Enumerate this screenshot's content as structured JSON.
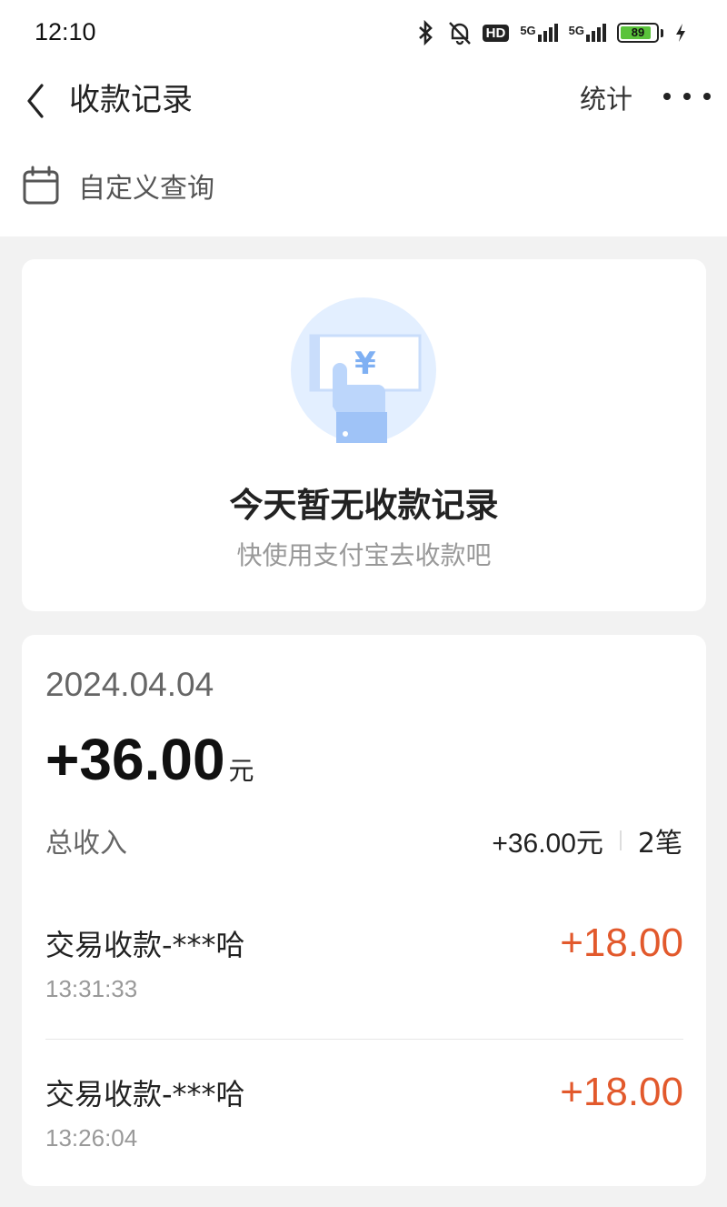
{
  "status_bar": {
    "time": "12:10",
    "icons": [
      "bluetooth-icon",
      "bell-muted-icon",
      "hd-icon",
      "signal-5g-icon",
      "signal-5g-icon",
      "battery-icon",
      "charging-icon"
    ],
    "hd_label": "HD",
    "network_1": "5G",
    "network_2": "5G",
    "battery_level": "89",
    "battery_fraction": 0.89
  },
  "header": {
    "title": "收款记录",
    "stats_label": "统计",
    "back_icon": "chevron-left-icon",
    "more_icon": "more-horizontal-icon"
  },
  "query": {
    "label": "自定义查询",
    "icon": "calendar-icon"
  },
  "empty_state": {
    "title": "今天暂无收款记录",
    "subtitle": "快使用支付宝去收款吧",
    "illustration_symbol": "¥"
  },
  "day_summary": {
    "date": "2024.04.04",
    "total_amount": "+36.00",
    "total_unit": "元",
    "income_label": "总收入",
    "summary_amount": "+36.00元",
    "summary_count": "2笔"
  },
  "transactions": [
    {
      "name": "交易收款-***哈",
      "time": "13:31:33",
      "amount": "+18.00"
    },
    {
      "name": "交易收款-***哈",
      "time": "13:26:04",
      "amount": "+18.00"
    }
  ],
  "colors": {
    "accent_amount": "#e2592c",
    "page_background": "#f2f2f2",
    "card_background": "#ffffff",
    "illustration_blue": "#e3efff"
  }
}
